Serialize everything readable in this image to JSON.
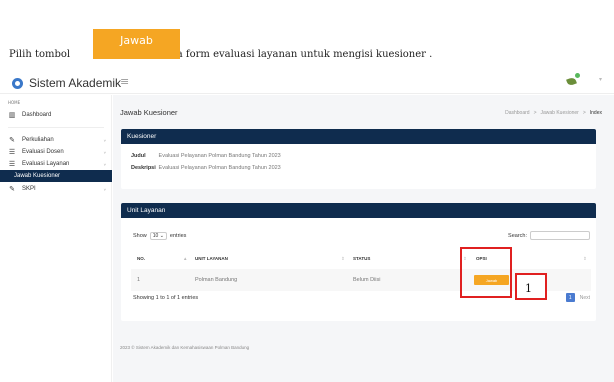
{
  "instruction": {
    "before": "Pilih tombol",
    "button_label": "Jawab",
    "after": "pada form evaluasi layanan untuk mengisi kuesioner ."
  },
  "app": {
    "name": "Sistem Akademik",
    "hamburger": "≡"
  },
  "sidebar": {
    "section_label": "HOME",
    "items": [
      {
        "label": "Dashboard",
        "icon": "chart-icon"
      },
      {
        "label": "Perkuliahan",
        "icon": "pencil-icon"
      },
      {
        "label": "Evaluasi Dosen",
        "icon": "list-icon"
      },
      {
        "label": "Evaluasi Layanan",
        "icon": "list-icon"
      },
      {
        "label": "Jawab Kuesioner",
        "icon": ""
      },
      {
        "label": "SKPI",
        "icon": "pencil-icon"
      }
    ],
    "chev": "˅"
  },
  "main": {
    "title": "Jawab Kuesioner",
    "breadcrumb": [
      "Dashboard",
      ">",
      "Jawab Kuesioner",
      ">",
      "Index"
    ]
  },
  "kuesioner": {
    "header": "Kuesioner",
    "judul_label": "Judul",
    "judul_value": "Evaluasi Pelayanan Polman Bandung Tahun 2023",
    "deskripsi_label": "Deskripsi",
    "deskripsi_value": "Evaluasi Pelayanan Polman Bandung Tahun 2023"
  },
  "unit": {
    "header": "Unit Layanan",
    "show_label": "Show",
    "show_value": "10",
    "entries_label": "entries",
    "search_label": "Search:",
    "columns": [
      "NO.",
      "UNIT LAYANAN",
      "STATUS",
      "OPSI"
    ],
    "rows": [
      {
        "no": "1",
        "unit": "Polman Bandung",
        "status": "Belum Diisi",
        "action": "Jawab"
      }
    ],
    "showing": "Showing 1 to 1 of 1 entries",
    "page": "1",
    "next": "Next"
  },
  "footer": "2023 © Sistem Akademik dan Kemahasiswaan Polman Bandung",
  "annotation_number": "1",
  "colors": {
    "navy": "#0f2c4e",
    "orange": "#f5a623",
    "red": "#e02020",
    "blue": "#4a7bd0"
  }
}
